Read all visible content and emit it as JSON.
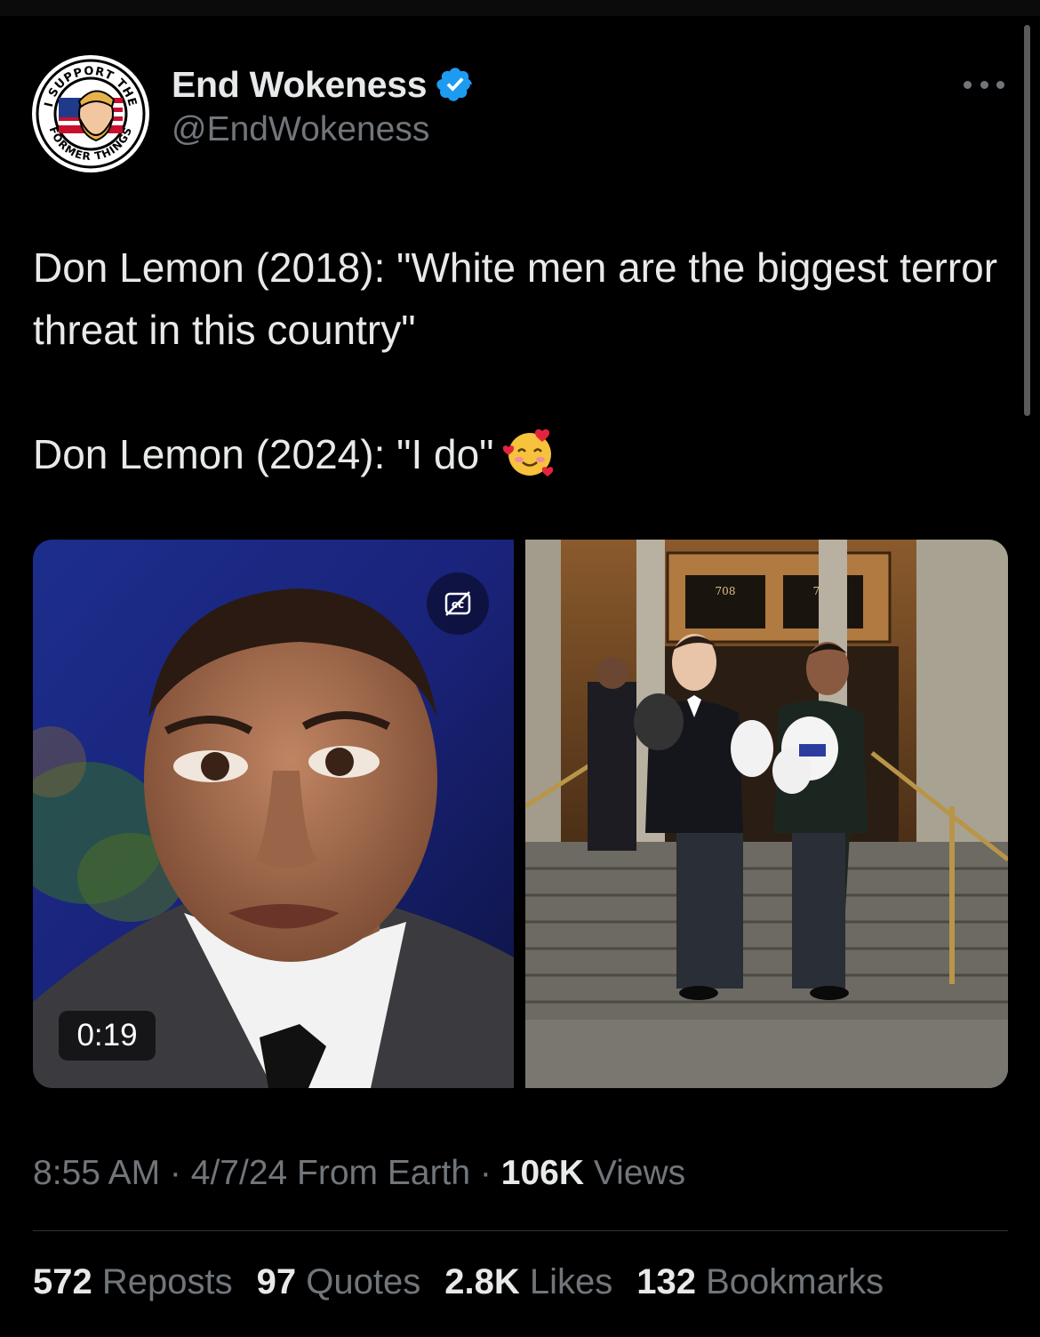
{
  "author": {
    "name": "End Wokeness",
    "handle": "@EndWokeness",
    "avatar_ring_top": "I SUPPORT THE",
    "avatar_ring_bottom": "FORMER THINGS",
    "verified": true
  },
  "tweet": {
    "line1": "Don Lemon (2018): \"White men are the biggest terror threat in this country\"",
    "line2": "Don Lemon (2024): \"I do\"",
    "emoji": "smiling-face-with-hearts"
  },
  "media": {
    "video_duration": "0:19",
    "building_number_left": "708",
    "building_number_right": "708"
  },
  "meta": {
    "time": "8:55 AM",
    "date": "4/7/24",
    "source": "From Earth",
    "views_count": "106K",
    "views_label": "Views"
  },
  "stats": {
    "reposts_count": "572",
    "reposts_label": "Reposts",
    "quotes_count": "97",
    "quotes_label": "Quotes",
    "likes_count": "2.8K",
    "likes_label": "Likes",
    "bookmarks_count": "132",
    "bookmarks_label": "Bookmarks"
  },
  "colors": {
    "background": "#000000",
    "text": "#e7e9ea",
    "secondary": "#71767b",
    "verified": "#1d9bf0"
  }
}
